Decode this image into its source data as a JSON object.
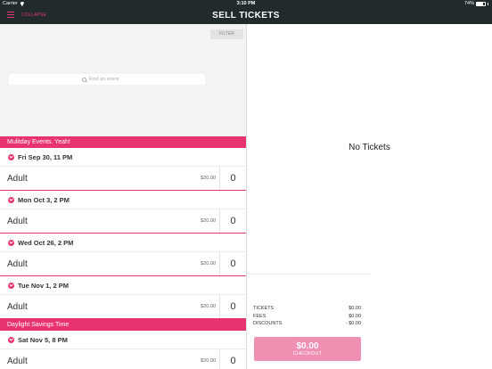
{
  "status_bar": {
    "carrier": "Carrier",
    "time": "3:10 PM",
    "battery": "74%",
    "battery_level": 0.74
  },
  "nav": {
    "collapse_label": "COLLAPSE",
    "title": "SELL TICKETS"
  },
  "filter_label": "FILTER",
  "search": {
    "placeholder": "Find an event"
  },
  "sections": [
    {
      "header": "Mulitday Events. Yeah!",
      "events": [
        {
          "date": "Fri Sep 30, 11 PM",
          "tickets": [
            {
              "name": "Adult",
              "price": "$20.00",
              "qty": "0"
            }
          ]
        },
        {
          "date": "Mon Oct 3, 2 PM",
          "tickets": [
            {
              "name": "Adult",
              "price": "$20.00",
              "qty": "0"
            }
          ]
        },
        {
          "date": "Wed Oct 26, 2 PM",
          "tickets": [
            {
              "name": "Adult",
              "price": "$20.00",
              "qty": "0"
            }
          ]
        },
        {
          "date": "Tue Nov 1, 2 PM",
          "tickets": [
            {
              "name": "Adult",
              "price": "$20.00",
              "qty": "0"
            }
          ]
        }
      ]
    },
    {
      "header": "Daylight Savings Time",
      "events": [
        {
          "date": "Sat Nov 5, 8 PM",
          "tickets": [
            {
              "name": "Adult",
              "price": "$20.00",
              "qty": "0"
            }
          ]
        }
      ]
    }
  ],
  "cart": {
    "empty_text": "No Tickets",
    "summary": [
      {
        "label": "TICKETS",
        "value": "$0.00"
      },
      {
        "label": "FEES",
        "value": "$0.00"
      },
      {
        "label": "DISCOUNTS",
        "value": "- $0.00"
      }
    ],
    "total": "$0.00",
    "checkout_label": "CHECKOUT"
  },
  "colors": {
    "accent": "#e8336f",
    "checkout": "#ef8fb1",
    "navbar": "#222b2b"
  }
}
